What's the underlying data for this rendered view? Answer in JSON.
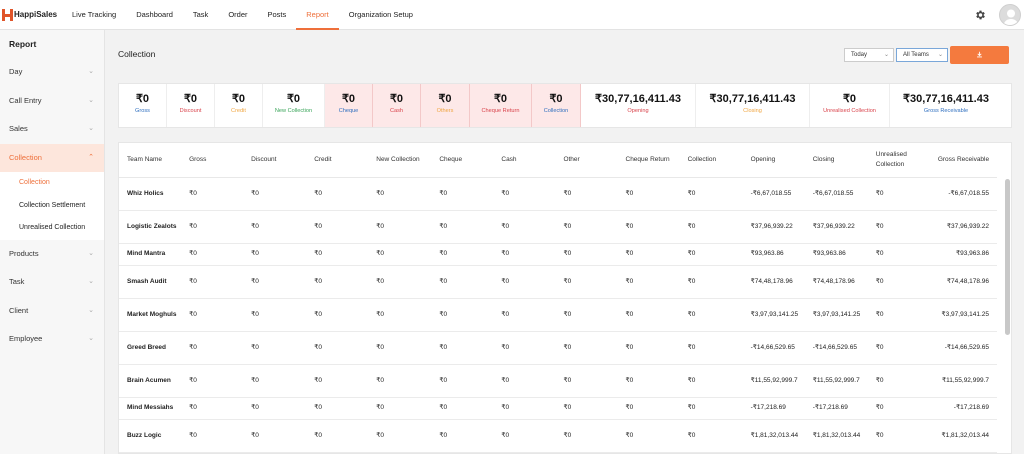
{
  "brand": {
    "name": "HappiSales"
  },
  "nav": [
    {
      "label": "Live Tracking",
      "active": false
    },
    {
      "label": "Dashboard",
      "active": false
    },
    {
      "label": "Task",
      "active": false
    },
    {
      "label": "Order",
      "active": false
    },
    {
      "label": "Posts",
      "active": false
    },
    {
      "label": "Report",
      "active": true
    },
    {
      "label": "Organization Setup",
      "active": false
    }
  ],
  "header_icons": {
    "settings": "gear-icon",
    "profile": "user-avatar-icon"
  },
  "sidebar": {
    "title": "Report",
    "items": [
      {
        "label": "Day"
      },
      {
        "label": "Call Entry"
      },
      {
        "label": "Sales"
      },
      {
        "label": "Collection",
        "active": true
      },
      {
        "label": "Products"
      },
      {
        "label": "Task"
      },
      {
        "label": "Client"
      },
      {
        "label": "Employee"
      }
    ],
    "subitems": [
      {
        "label": "Collection",
        "active": true
      },
      {
        "label": "Collection Settlement"
      },
      {
        "label": "Unrealised Collection"
      }
    ]
  },
  "page": {
    "title": "Collection",
    "filter_period": "Today",
    "filter_team": "All Teams",
    "download_icon": "download-icon"
  },
  "summary": [
    {
      "value": "₹0",
      "label": "Gross",
      "color": "#2f6fbf",
      "pink": false
    },
    {
      "value": "₹0",
      "label": "Discount",
      "color": "#d9434b",
      "pink": false
    },
    {
      "value": "₹0",
      "label": "Credit",
      "color": "#f0a540",
      "pink": false
    },
    {
      "value": "₹0",
      "label": "New Collection",
      "color": "#3aa55a",
      "pink": false
    },
    {
      "value": "₹0",
      "label": "Cheque",
      "color": "#2f6fbf",
      "pink": true
    },
    {
      "value": "₹0",
      "label": "Cash",
      "color": "#d9434b",
      "pink": true
    },
    {
      "value": "₹0",
      "label": "Others",
      "color": "#f0a540",
      "pink": true
    },
    {
      "value": "₹0",
      "label": "Cheque Return",
      "color": "#d9434b",
      "pink": true
    },
    {
      "value": "₹0",
      "label": "Collection",
      "color": "#2f6fbf",
      "pink": true
    },
    {
      "value": "₹30,77,16,411.43",
      "label": "Opening",
      "color": "#d9434b",
      "pink": false
    },
    {
      "value": "₹30,77,16,411.43",
      "label": "Closing",
      "color": "#f0a540",
      "pink": false
    },
    {
      "value": "₹0",
      "label": "Unrealised Collection",
      "color": "#d9434b",
      "pink": false
    },
    {
      "value": "₹30,77,16,411.43",
      "label": "Gross Receivable",
      "color": "#2f6fbf",
      "pink": false
    }
  ],
  "table": {
    "columns": [
      "Team Name",
      "Gross",
      "Discount",
      "Credit",
      "New Collection",
      "Cheque",
      "Cash",
      "Other",
      "Cheque Return",
      "Collection",
      "Opening",
      "Closing",
      "Unrealised Collection",
      "Gross Receivable"
    ],
    "rows": [
      [
        "Whiz Holics",
        "₹0",
        "₹0",
        "₹0",
        "₹0",
        "₹0",
        "₹0",
        "₹0",
        "₹0",
        "₹0",
        "-₹6,67,018.55",
        "-₹6,67,018.55",
        "₹0",
        "-₹6,67,018.55"
      ],
      [
        "Logistic Zealots",
        "₹0",
        "₹0",
        "₹0",
        "₹0",
        "₹0",
        "₹0",
        "₹0",
        "₹0",
        "₹0",
        "₹37,96,939.22",
        "₹37,96,939.22",
        "₹0",
        "₹37,96,939.22"
      ],
      [
        "Mind Mantra",
        "₹0",
        "₹0",
        "₹0",
        "₹0",
        "₹0",
        "₹0",
        "₹0",
        "₹0",
        "₹0",
        "₹93,963.86",
        "₹93,963.86",
        "₹0",
        "₹93,963.86"
      ],
      [
        "Smash Audit",
        "₹0",
        "₹0",
        "₹0",
        "₹0",
        "₹0",
        "₹0",
        "₹0",
        "₹0",
        "₹0",
        "₹74,48,178.96",
        "₹74,48,178.96",
        "₹0",
        "₹74,48,178.96"
      ],
      [
        "Market Moghuls",
        "₹0",
        "₹0",
        "₹0",
        "₹0",
        "₹0",
        "₹0",
        "₹0",
        "₹0",
        "₹0",
        "₹3,97,93,141.25",
        "₹3,97,93,141.25",
        "₹0",
        "₹3,97,93,141.25"
      ],
      [
        "Greed Breed",
        "₹0",
        "₹0",
        "₹0",
        "₹0",
        "₹0",
        "₹0",
        "₹0",
        "₹0",
        "₹0",
        "-₹14,66,529.65",
        "-₹14,66,529.65",
        "₹0",
        "-₹14,66,529.65"
      ],
      [
        "Brain Acumen",
        "₹0",
        "₹0",
        "₹0",
        "₹0",
        "₹0",
        "₹0",
        "₹0",
        "₹0",
        "₹0",
        "₹11,55,92,999.7",
        "₹11,55,92,999.7",
        "₹0",
        "₹11,55,92,999.7"
      ],
      [
        "Mind Messiahs",
        "₹0",
        "₹0",
        "₹0",
        "₹0",
        "₹0",
        "₹0",
        "₹0",
        "₹0",
        "₹0",
        "-₹17,218.69",
        "-₹17,218.69",
        "₹0",
        "-₹17,218.69"
      ],
      [
        "Buzz Logic",
        "₹0",
        "₹0",
        "₹0",
        "₹0",
        "₹0",
        "₹0",
        "₹0",
        "₹0",
        "₹0",
        "₹1,81,32,013.44",
        "₹1,81,32,013.44",
        "₹0",
        "₹1,81,32,013.44"
      ]
    ]
  }
}
